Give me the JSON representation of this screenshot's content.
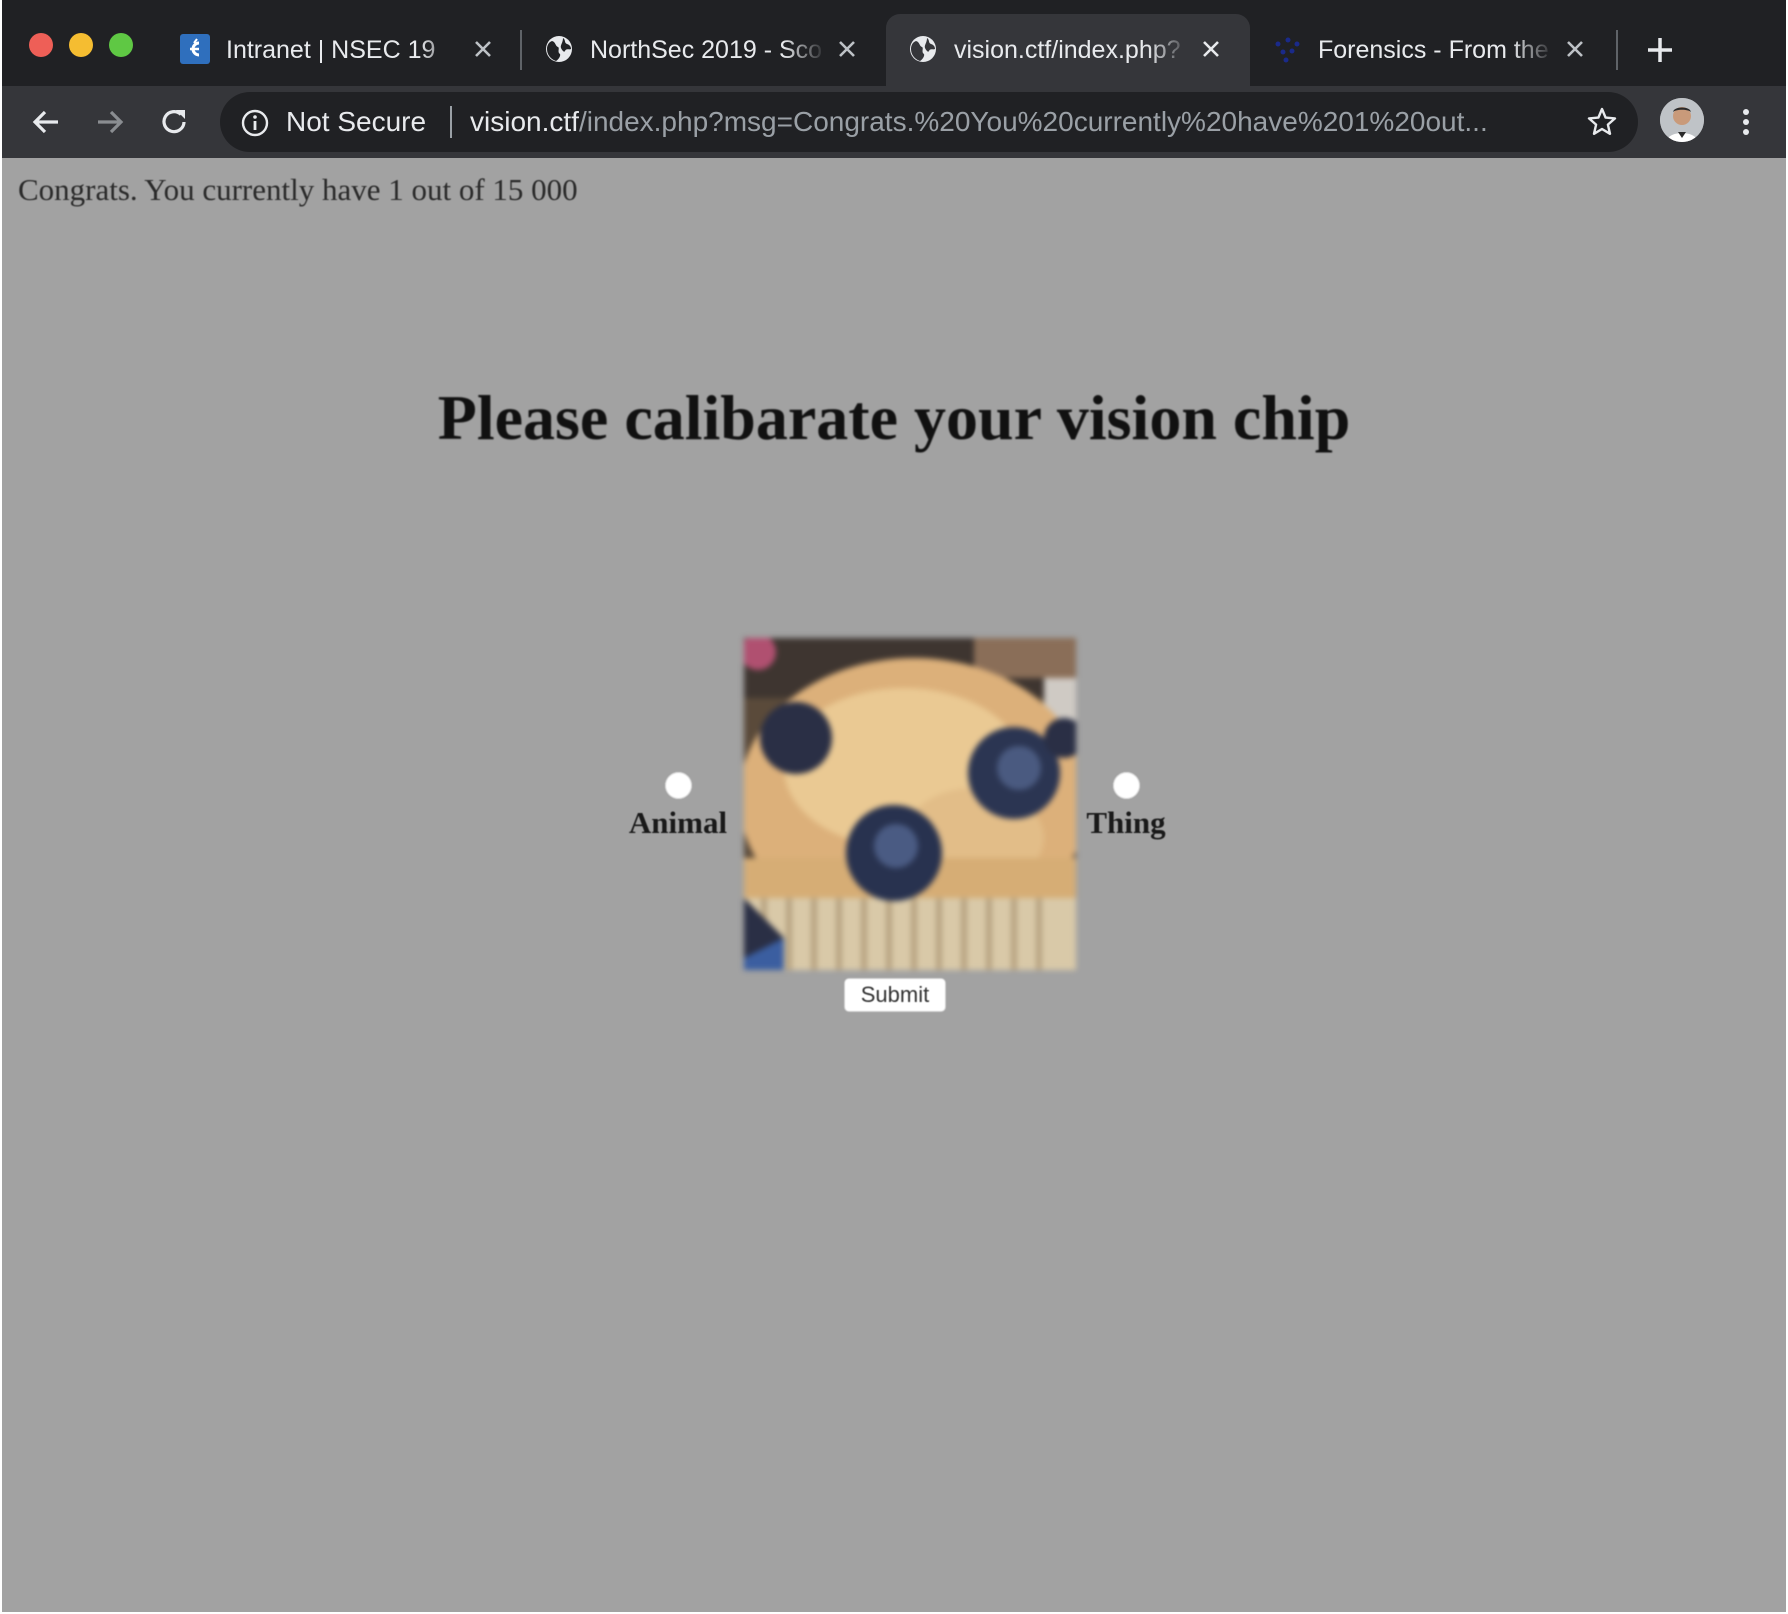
{
  "browser": {
    "tabs": [
      {
        "title": "Intranet | NSEC 19",
        "favicon": "nsec-icon",
        "active": false
      },
      {
        "title": "NorthSec 2019 - Sco",
        "favicon": "globe-icon",
        "active": false
      },
      {
        "title": "vision.ctf/index.php?",
        "favicon": "globe-icon",
        "active": true
      },
      {
        "title": "Forensics - From the",
        "favicon": "dots-icon",
        "active": false
      }
    ],
    "security_label": "Not Secure",
    "url_host": "vision.ctf",
    "url_path": "/index.php?msg=Congrats.%20You%20currently%20have%201%20out...",
    "colors": {
      "tabstrip": "#202124",
      "toolbar": "#35363a",
      "omnibox": "#202124",
      "page_bg": "#a2a2a2"
    }
  },
  "page": {
    "message": "Congrats. You currently have 1 out of 15 000",
    "heading": "Please calibarate your vision chip",
    "options": [
      {
        "label": "Animal",
        "selected": false
      },
      {
        "label": "Thing",
        "selected": false
      }
    ],
    "image_subject": "blueberry-muffin",
    "submit_label": "Submit"
  }
}
